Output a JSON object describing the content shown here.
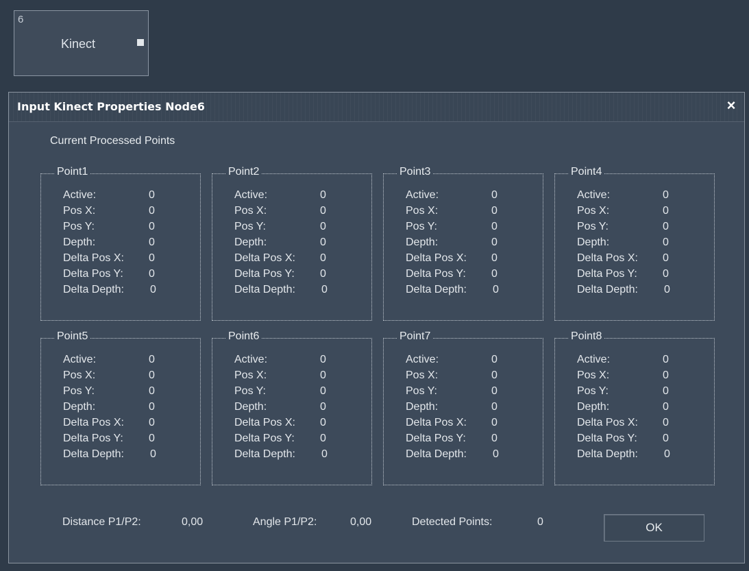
{
  "node": {
    "id": "6",
    "label": "Kinect"
  },
  "dialog": {
    "title": "Input Kinect Properties Node6",
    "close_glyph": "×",
    "section_title": "Current Processed Points",
    "field_labels": {
      "active": "Active:",
      "pos_x": "Pos X:",
      "pos_y": "Pos Y:",
      "depth": "Depth:",
      "delta_pos_x": "Delta Pos X:",
      "delta_pos_y": "Delta Pos Y:",
      "delta_depth": "Delta Depth:"
    },
    "points": [
      {
        "name": "Point1",
        "active": "0",
        "pos_x": "0",
        "pos_y": "0",
        "depth": "0",
        "delta_pos_x": "0",
        "delta_pos_y": "0",
        "delta_depth": "0"
      },
      {
        "name": "Point2",
        "active": "0",
        "pos_x": "0",
        "pos_y": "0",
        "depth": "0",
        "delta_pos_x": "0",
        "delta_pos_y": "0",
        "delta_depth": "0"
      },
      {
        "name": "Point3",
        "active": "0",
        "pos_x": "0",
        "pos_y": "0",
        "depth": "0",
        "delta_pos_x": "0",
        "delta_pos_y": "0",
        "delta_depth": "0"
      },
      {
        "name": "Point4",
        "active": "0",
        "pos_x": "0",
        "pos_y": "0",
        "depth": "0",
        "delta_pos_x": "0",
        "delta_pos_y": "0",
        "delta_depth": "0"
      },
      {
        "name": "Point5",
        "active": "0",
        "pos_x": "0",
        "pos_y": "0",
        "depth": "0",
        "delta_pos_x": "0",
        "delta_pos_y": "0",
        "delta_depth": "0"
      },
      {
        "name": "Point6",
        "active": "0",
        "pos_x": "0",
        "pos_y": "0",
        "depth": "0",
        "delta_pos_x": "0",
        "delta_pos_y": "0",
        "delta_depth": "0"
      },
      {
        "name": "Point7",
        "active": "0",
        "pos_x": "0",
        "pos_y": "0",
        "depth": "0",
        "delta_pos_x": "0",
        "delta_pos_y": "0",
        "delta_depth": "0"
      },
      {
        "name": "Point8",
        "active": "0",
        "pos_x": "0",
        "pos_y": "0",
        "depth": "0",
        "delta_pos_x": "0",
        "delta_pos_y": "0",
        "delta_depth": "0"
      }
    ],
    "footer": {
      "distance_label": "Distance P1/P2:",
      "distance_value": "0,00",
      "angle_label": "Angle P1/P2:",
      "angle_value": "0,00",
      "detected_label": "Detected Points:",
      "detected_value": "0",
      "ok_label": "OK"
    }
  }
}
